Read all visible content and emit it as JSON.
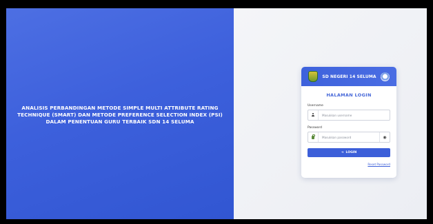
{
  "hero": {
    "title": "ANALISIS PERBANDINGAN METODE SIMPLE MULTI ATTRIBUTE RATING TECHNIQUE (SMART) DAN METODE PREFERENCE SELECTION INDEX (PSI) DALAM PENENTUAN GURU TERBAIK SDN 14 SELUMA"
  },
  "card": {
    "school_name": "SD NEGERI 14 SELUMA",
    "login_title": "HALAMAN LOGIN",
    "username": {
      "label": "Username",
      "placeholder": "Masukkan username",
      "value": ""
    },
    "password": {
      "label": "Password",
      "placeholder": "Masukkan password",
      "value": ""
    },
    "login_button": "LOGIN",
    "reset_link": "Reset Password"
  },
  "icons": {
    "school_logo": "school-emblem-icon",
    "crest": "tut-wuri-handayani-icon",
    "user": "user-icon",
    "lock": "lock-icon",
    "eye": "eye-icon",
    "login": "sign-in-icon"
  },
  "colors": {
    "primary": "#3c5fd9",
    "hero_bg": "#3d60dc",
    "page_bg": "#eceef3"
  }
}
